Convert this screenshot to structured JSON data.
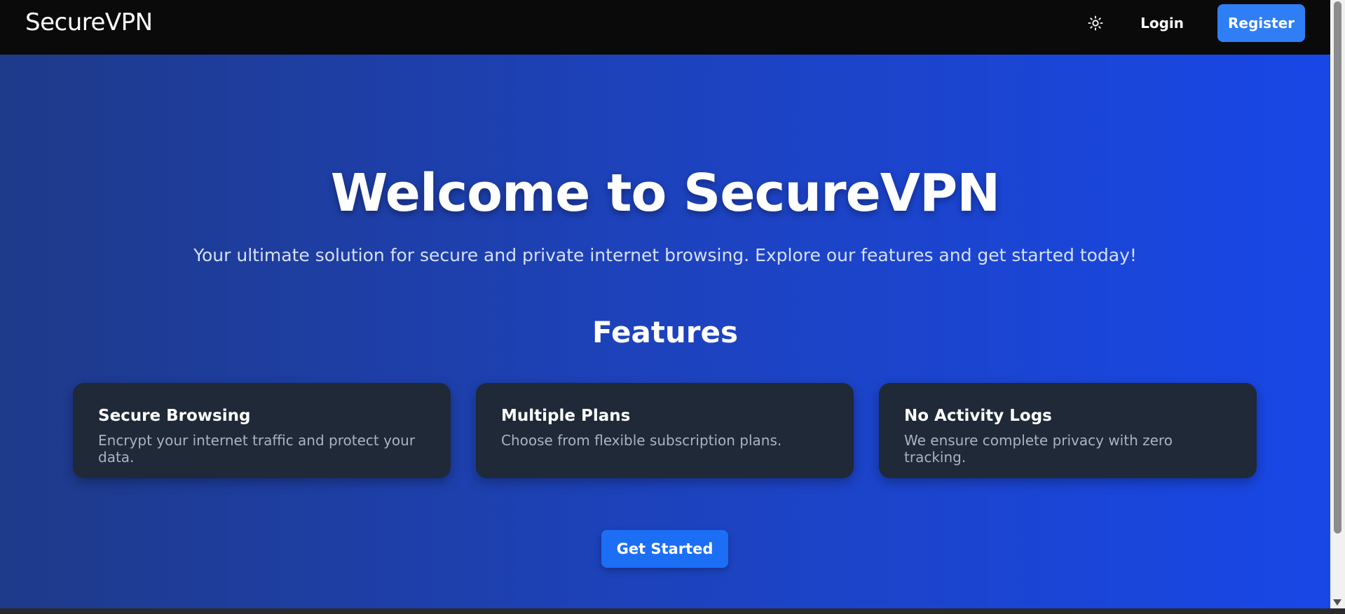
{
  "navbar": {
    "brand": "SecureVPN",
    "theme_icon": "sun-icon",
    "login_label": "Login",
    "register_label": "Register"
  },
  "hero": {
    "title": "Welcome to SecureVPN",
    "subtitle": "Your ultimate solution for secure and private internet browsing. Explore our features and get started today!",
    "features_heading": "Features",
    "features": [
      {
        "title": "Secure Browsing",
        "description": "Encrypt your internet traffic and protect your data."
      },
      {
        "title": "Multiple Plans",
        "description": "Choose from flexible subscription plans."
      },
      {
        "title": "No Activity Logs",
        "description": "We ensure complete privacy with zero tracking."
      }
    ],
    "cta_label": "Get Started"
  },
  "colors": {
    "navbar_bg": "#0a0a0a",
    "hero_gradient_start": "#1e3a8a",
    "hero_gradient_end": "#1847e6",
    "card_bg": "#1f2937",
    "accent_blue": "#2f7ef5"
  }
}
